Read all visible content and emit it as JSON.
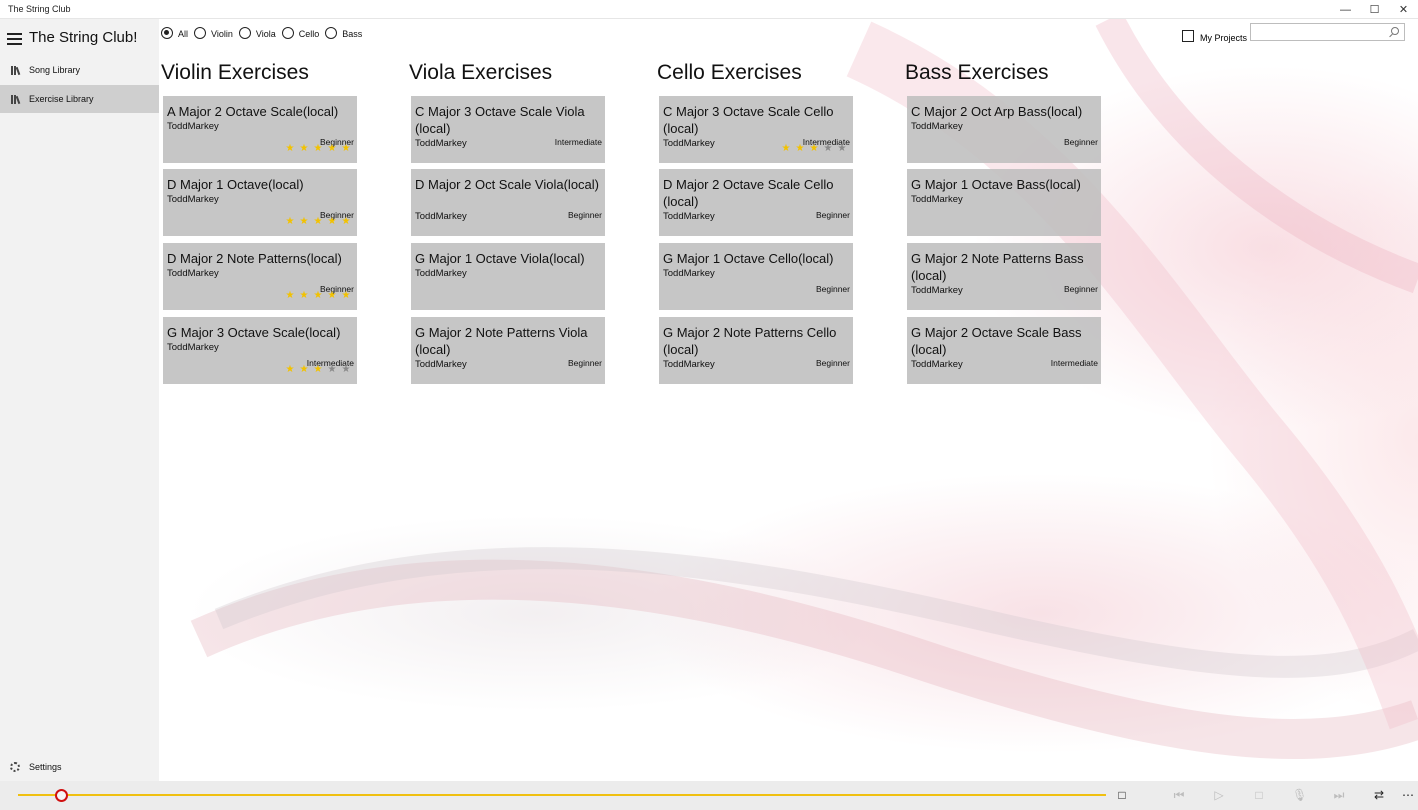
{
  "window": {
    "title": "The String Club",
    "minimize": "—",
    "maximize": "☐",
    "close": "✕"
  },
  "sidebar": {
    "app_name": "The String Club!",
    "items": [
      {
        "label": "Song Library",
        "selected": false
      },
      {
        "label": "Exercise Library",
        "selected": true
      }
    ],
    "settings_label": "Settings"
  },
  "filters": {
    "options": [
      {
        "label": "All",
        "selected": true
      },
      {
        "label": "Violin",
        "selected": false
      },
      {
        "label": "Viola",
        "selected": false
      },
      {
        "label": "Cello",
        "selected": false
      },
      {
        "label": "Bass",
        "selected": false
      }
    ],
    "my_projects_label": "My Projects",
    "my_projects_checked": false,
    "search_value": ""
  },
  "colors": {
    "star_filled": "#f2c200",
    "star_empty": "#8a8a8a",
    "progress": "#f0c010",
    "progress_thumb": "#d01010"
  },
  "columns": [
    {
      "title": "Violin Exercises",
      "cards": [
        {
          "title": "A Major 2 Octave Scale(local)",
          "author": "ToddMarkey",
          "level": "Beginner",
          "rating": 5
        },
        {
          "title": "D Major 1 Octave(local)",
          "author": "ToddMarkey",
          "level": "Beginner",
          "rating": 5
        },
        {
          "title": "D Major 2 Note Patterns(local)",
          "author": "ToddMarkey",
          "level": "Beginner",
          "rating": 5
        },
        {
          "title": "G Major 3 Octave Scale(local)",
          "author": "ToddMarkey",
          "level": "Intermediate",
          "rating": 3
        }
      ]
    },
    {
      "title": "Viola Exercises",
      "cards": [
        {
          "title": "C Major 3 Octave Scale Viola (local)",
          "author": "ToddMarkey",
          "level": "Intermediate",
          "rating": 0
        },
        {
          "title": "D Major 2 Oct Scale Viola(local)",
          "author": "ToddMarkey",
          "level": "Beginner",
          "rating": 0
        },
        {
          "title": "G Major 1 Octave Viola(local)",
          "author": "ToddMarkey",
          "level": "",
          "rating": 0
        },
        {
          "title": "G Major 2 Note Patterns Viola (local)",
          "author": "ToddMarkey",
          "level": "Beginner",
          "rating": 0
        }
      ]
    },
    {
      "title": "Cello Exercises",
      "cards": [
        {
          "title": "C Major 3 Octave Scale Cello (local)",
          "author": "ToddMarkey",
          "level": "Intermediate",
          "rating": 3
        },
        {
          "title": "D Major 2 Octave Scale Cello (local)",
          "author": "ToddMarkey",
          "level": "Beginner",
          "rating": 0
        },
        {
          "title": "G Major 1 Octave Cello(local)",
          "author": "ToddMarkey",
          "level": "Beginner",
          "rating": 0
        },
        {
          "title": "G Major 2 Note Patterns Cello (local)",
          "author": "ToddMarkey",
          "level": "Beginner",
          "rating": 0
        }
      ]
    },
    {
      "title": "Bass Exercises",
      "cards": [
        {
          "title": "C Major 2 Oct Arp Bass(local)",
          "author": "ToddMarkey",
          "level": "Beginner",
          "rating": 0
        },
        {
          "title": "G Major 1 Octave Bass(local)",
          "author": "ToddMarkey",
          "level": "",
          "rating": 0
        },
        {
          "title": "G Major 2 Note Patterns Bass (local)",
          "author": "ToddMarkey",
          "level": "Beginner",
          "rating": 0
        },
        {
          "title": "G Major 2 Octave Scale Bass (local)",
          "author": "ToddMarkey",
          "level": "Intermediate",
          "rating": 0
        }
      ]
    }
  ],
  "player": {
    "progress_fraction": 0.04,
    "stop_square": "□",
    "buttons": [
      {
        "name": "skip-back",
        "glyph": "⏮",
        "enabled": false
      },
      {
        "name": "play",
        "glyph": "▷",
        "enabled": false
      },
      {
        "name": "stop",
        "glyph": "□",
        "enabled": false
      },
      {
        "name": "record",
        "glyph": "🎙",
        "enabled": false
      },
      {
        "name": "skip-forward",
        "glyph": "⏭",
        "enabled": false
      },
      {
        "name": "repeat",
        "glyph": "⇄",
        "enabled": true
      },
      {
        "name": "more",
        "glyph": "⋯",
        "enabled": true
      }
    ]
  }
}
